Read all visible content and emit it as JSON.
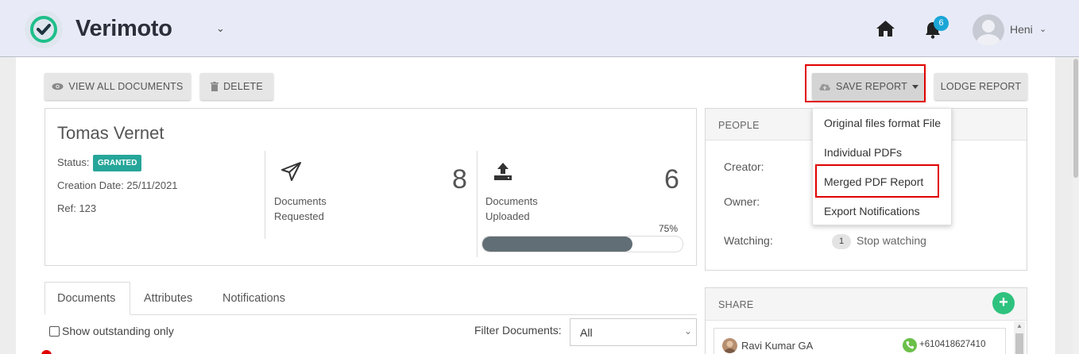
{
  "header": {
    "brand": "Verimoto",
    "notification_count": "6",
    "user_name": "Heni",
    "brand_caret": "⌄",
    "user_caret": "⌄"
  },
  "toolbar": {
    "view_all": "VIEW ALL DOCUMENTS",
    "delete": "DELETE",
    "save_report": "SAVE REPORT",
    "lodge_report": "LODGE REPORT"
  },
  "report_menu": {
    "items": [
      "Original files format File",
      "Individual PDFs",
      "Merged PDF Report",
      "Export Notifications"
    ]
  },
  "request": {
    "name": "Tomas Vernet",
    "status_label": "Status:",
    "status": "GRANTED",
    "creation_date": "Creation Date: 25/11/2021",
    "ref": "Ref: 123",
    "requested_label_1": "Documents",
    "requested_label_2": "Requested",
    "requested_count": "8",
    "uploaded_label_1": "Documents",
    "uploaded_label_2": "Uploaded",
    "uploaded_count": "6",
    "progress_text": "75%",
    "progress_value": 75
  },
  "people": {
    "title": "PEOPLE",
    "creator_label": "Creator:",
    "owner_label": "Owner:",
    "watching_label": "Watching:",
    "watching_count": "1",
    "stop_watching": "Stop watching"
  },
  "tabs": [
    "Documents",
    "Attributes",
    "Notifications"
  ],
  "filters": {
    "outstanding_label": "Show outstanding only",
    "filter_label": "Filter Documents:",
    "filter_value": "All"
  },
  "share": {
    "title": "SHARE",
    "add": "+",
    "contact_name": "Ravi Kumar GA",
    "contact_phone": "+610418627410"
  },
  "colors": {
    "accent_green": "#26a69a",
    "badge_blue": "#1ba6d6",
    "highlight_red": "#e00000",
    "progress_fill": "#626e75"
  },
  "icons": [
    "check-circle-logo",
    "home-icon",
    "bell-icon",
    "user-avatar",
    "eye-icon",
    "trash-icon",
    "cloud-icon",
    "send-icon",
    "upload-icon",
    "phone-icon"
  ]
}
